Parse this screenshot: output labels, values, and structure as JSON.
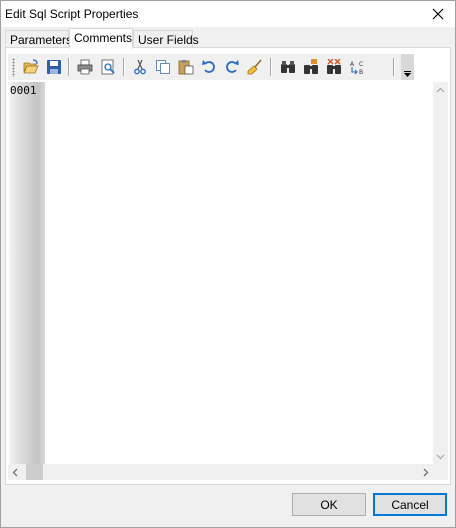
{
  "window": {
    "title": "Edit Sql Script Properties"
  },
  "tabs": [
    {
      "label": "Parameters",
      "active": false
    },
    {
      "label": "Comments",
      "active": true
    },
    {
      "label": "User Fields",
      "active": false
    }
  ],
  "toolbar": {
    "icons": [
      "open-icon",
      "save-icon",
      "print-icon",
      "print-preview-icon",
      "cut-icon",
      "copy-icon",
      "paste-icon",
      "undo-icon",
      "redo-icon",
      "clear-icon",
      "find-icon",
      "find-next-icon",
      "replace-icon",
      "goto-icon",
      "toolbar-overflow-icon"
    ]
  },
  "editor": {
    "line_number": "0001",
    "content": ""
  },
  "buttons": {
    "ok": "OK",
    "cancel": "Cancel"
  }
}
